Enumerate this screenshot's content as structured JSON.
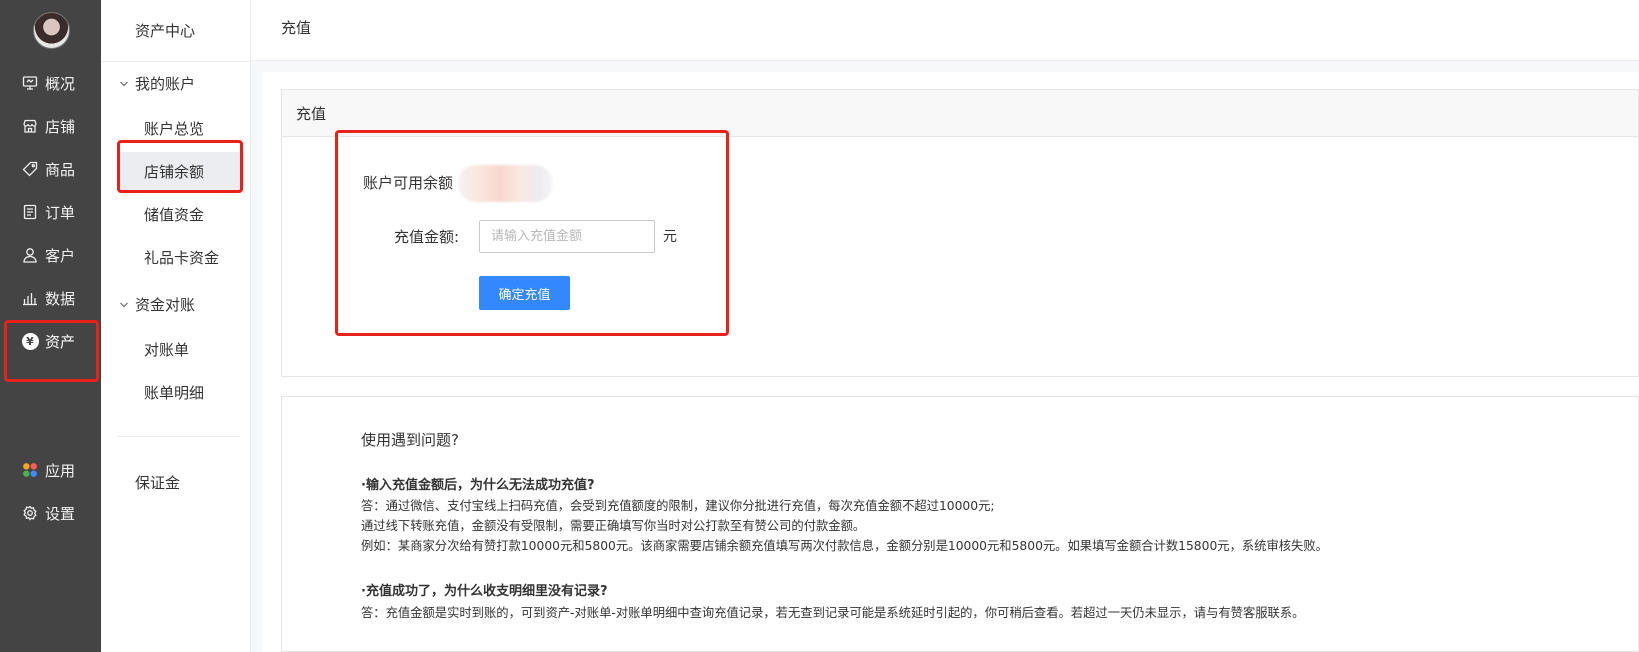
{
  "nav": {
    "items": [
      {
        "key": "overview",
        "label": "概况"
      },
      {
        "key": "store",
        "label": "店铺"
      },
      {
        "key": "goods",
        "label": "商品"
      },
      {
        "key": "orders",
        "label": "订单"
      },
      {
        "key": "customers",
        "label": "客户"
      },
      {
        "key": "data",
        "label": "数据"
      },
      {
        "key": "assets",
        "label": "资产"
      },
      {
        "key": "apps",
        "label": "应用"
      },
      {
        "key": "settings",
        "label": "设置"
      }
    ],
    "assets_icon_glyph": "¥"
  },
  "submenu": {
    "title": "资产中心",
    "group1": "我的账户",
    "group1_items": [
      "账户总览",
      "店铺余额",
      "储值资金",
      "礼品卡资金"
    ],
    "group2": "资金对账",
    "group2_items": [
      "对账单",
      "账单明细"
    ],
    "deposit": "保证金"
  },
  "header": {
    "breadcrumb": "充值"
  },
  "recharge": {
    "card_title": "充值",
    "balance_label": "账户可用余额",
    "amount_label": "充值金额:",
    "amount_placeholder": "请输入充值金额",
    "unit": "元",
    "confirm_button": "确定充值"
  },
  "faq": {
    "title": "使用遇到问题?",
    "q1": "·输入充值金额后，为什么无法成功充值?",
    "a1_line1": "答：通过微信、支付宝线上扫码充值，会受到充值额度的限制，建议你分批进行充值，每次充值金额不超过10000元;",
    "a1_line2": "通过线下转账充值，金额没有受限制，需要正确填写你当时对公打款至有赞公司的付款金额。",
    "a1_line3": "例如：某商家分次给有赞打款10000元和5800元。该商家需要店铺余额充值填写两次付款信息，金额分别是10000元和5800元。如果填写金额合计数15800元，系统审核失败。",
    "q2": "·充值成功了，为什么收支明细里没有记录?",
    "a2_line1": "答：充值金额是实时到账的，可到资产-对账单-对账单明细中查询充值记录，若无查到记录可能是系统延时引起的，你可稍后查看。若超过一天仍未显示，请与有赞客服联系。"
  },
  "colors": {
    "nav_bg": "#444444",
    "primary_button": "#3388ff",
    "annotation_red": "#e8221b"
  }
}
